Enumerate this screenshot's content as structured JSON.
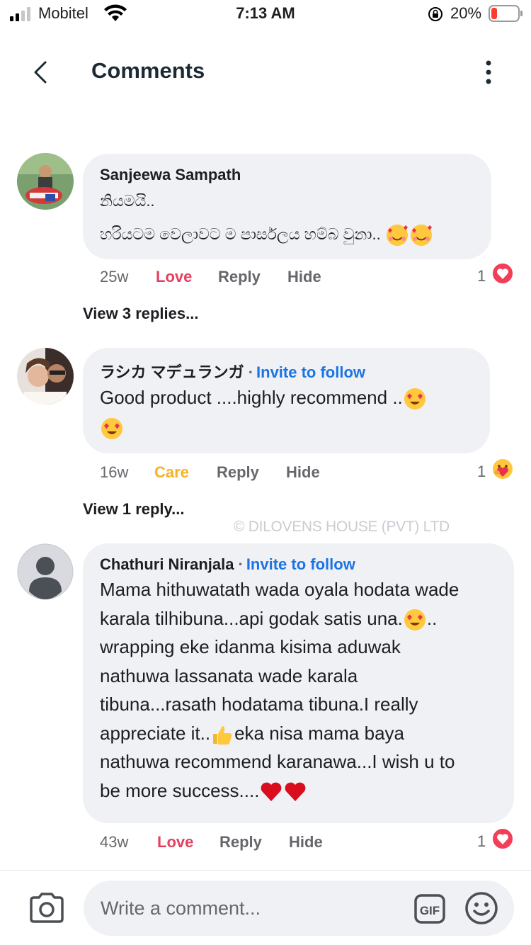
{
  "status_bar": {
    "carrier": "Mobitel",
    "time": "7:13 AM",
    "battery": "20%"
  },
  "header": {
    "title": "Comments"
  },
  "comments": [
    {
      "author": "Sanjeewa Sampath",
      "line1": "නියමයි..",
      "line2": "හරියටම වෙලාවට ම පාර්සලය හම්බ වුනා..",
      "time": "25w",
      "reaction_label": "Love",
      "reply_label": "Reply",
      "hide_label": "Hide",
      "reaction_count": "1",
      "replies": "View 3 replies..."
    },
    {
      "author": "ラシカ マデュランガ",
      "separator": "·",
      "invite": "Invite to follow",
      "text": "Good  product ....highly recommend ..",
      "time": "16w",
      "reaction_label": "Care",
      "reply_label": "Reply",
      "hide_label": "Hide",
      "reaction_count": "1",
      "replies": "View 1 reply..."
    },
    {
      "author": "Chathuri Niranjala",
      "separator": "·",
      "invite": "Invite to follow",
      "lines": [
        "Mama hithuwatath wada oyala hodata wade",
        "karala tilhibuna...api godak satis una.",
        "..",
        "wrapping eke idanma kisima aduwak",
        "nathuwa lassanata wade karala",
        "tibuna...rasath hodatama tibuna.I really",
        "appreciate it..",
        "eka nisa mama baya",
        "nathuwa recommend karanawa...I wish u to",
        "be more success...."
      ],
      "time": "43w",
      "reaction_label": "Love",
      "reply_label": "Reply",
      "hide_label": "Hide",
      "reaction_count": "1"
    }
  ],
  "watermark": "© DILOVENS HOUSE (PVT) LTD",
  "composer": {
    "placeholder": "Write a comment..."
  },
  "colors": {
    "love": "#e4405f",
    "care": "#f7b125",
    "link": "#1b74e4",
    "bubble": "#f0f1f4"
  }
}
